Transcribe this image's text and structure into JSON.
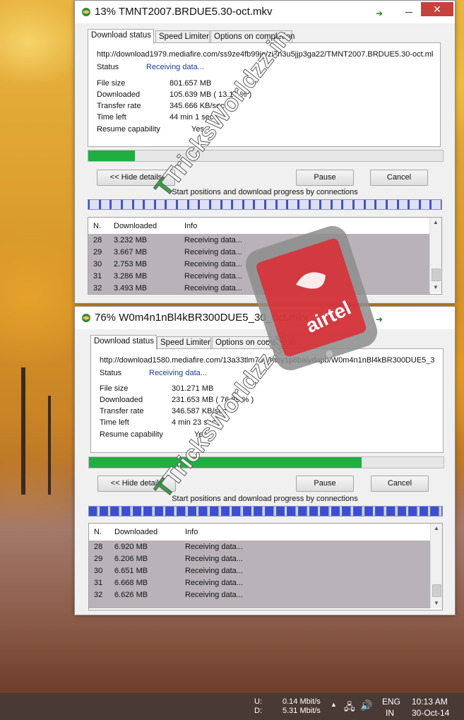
{
  "dialog1": {
    "title": "13% TMNT2007.BRDUE5.30-oct.mkv",
    "tabs": [
      "Download status",
      "Speed Limiter",
      "Options on completion"
    ],
    "url": "http://download1979.mediafire.com/ss9ze4fb99jg/zi7h3u5jjp3ga22/TMNT2007.BRDUE5.30-oct.mkv",
    "status_label": "Status",
    "status_value": "Receiving data...",
    "file_size_label": "File size",
    "file_size": "801.657  MB",
    "downloaded_label": "Downloaded",
    "downloaded": "105.639  MB  ( 13.17 % )",
    "transfer_rate_label": "Transfer rate",
    "transfer_rate": "345.666  KB/sec",
    "time_left_label": "Time left",
    "time_left": "44 min 1 sec",
    "resume_label": "Resume capability",
    "resume_value": "Yes",
    "progress_percent": 13.17,
    "hide_details": "<< Hide details",
    "pause": "Pause",
    "cancel": "Cancel",
    "connections_caption": "Start positions and download progress by connections",
    "table_headers": [
      "N.",
      "Downloaded",
      "Info"
    ],
    "rows": [
      {
        "n": "28",
        "downloaded": "3.232  MB",
        "info": "Receiving data..."
      },
      {
        "n": "29",
        "downloaded": "3.667  MB",
        "info": "Receiving data..."
      },
      {
        "n": "30",
        "downloaded": "2.753  MB",
        "info": "Receiving data..."
      },
      {
        "n": "31",
        "downloaded": "3.286  MB",
        "info": "Receiving data..."
      },
      {
        "n": "32",
        "downloaded": "3.493  MB",
        "info": "Receiving data..."
      }
    ]
  },
  "dialog2": {
    "title": "76% W0m4n1nBl4kBR300DUE5_30_oct.mkv",
    "tabs": [
      "Download status",
      "Speed Limiter",
      "Options on completion"
    ],
    "url": "http://download1580.mediafire.com/13a33tlm7og/hvry1p8baiydapb/W0m4n1nBl4kBR300DUE5_3",
    "status_label": "Status",
    "status_value": "Receiving data...",
    "file_size_label": "File size",
    "file_size": "301.271  MB",
    "downloaded_label": "Downloaded",
    "downloaded": "231.653  MB  ( 76.89 % )",
    "transfer_rate_label": "Transfer rate",
    "transfer_rate": "346.587  KB/sec",
    "time_left_label": "Time left",
    "time_left": "4 min 23 sec",
    "resume_label": "Resume capability",
    "resume_value": "Yes",
    "progress_percent": 76.89,
    "hide_details": "<< Hide details",
    "pause": "Pause",
    "cancel": "Cancel",
    "connections_caption": "Start positions and download progress by connections",
    "table_headers": [
      "N.",
      "Downloaded",
      "Info"
    ],
    "rows": [
      {
        "n": "28",
        "downloaded": "6.920  MB",
        "info": "Receiving data..."
      },
      {
        "n": "29",
        "downloaded": "6.206  MB",
        "info": "Receiving data..."
      },
      {
        "n": "30",
        "downloaded": "6.651  MB",
        "info": "Receiving data..."
      },
      {
        "n": "31",
        "downloaded": "6.668  MB",
        "info": "Receiving data..."
      },
      {
        "n": "32",
        "downloaded": "6.626  MB",
        "info": "Receiving data..."
      }
    ]
  },
  "watermark": {
    "site": "TricksWorldzz.in",
    "brand": "airtel"
  },
  "taskbar": {
    "upload_label": "U:",
    "download_label": "D:",
    "upload_speed": "0.14 Mbit/s",
    "download_speed": "5.31 Mbit/s",
    "language": "ENG",
    "region": "IN",
    "time": "10:13 AM",
    "date": "30-Oct-14"
  },
  "colors": {
    "progress_green": "#1fae3f",
    "close_red": "#c7413b",
    "status_blue": "#1b3e8c",
    "row_bg": "#b9b3b9",
    "airtel_red": "#e2232a"
  }
}
